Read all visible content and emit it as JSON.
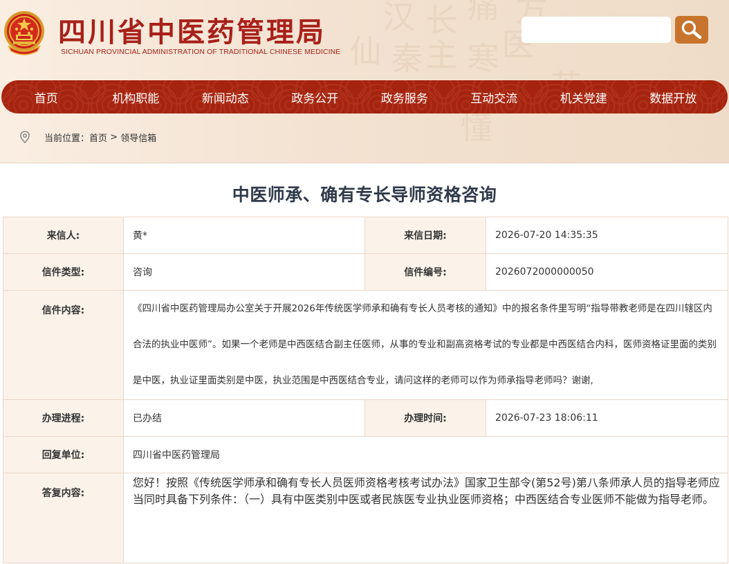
{
  "header": {
    "site_title": "四川省中医药管理局",
    "site_subtitle": "SICHUAN PROVINCIAL ADMINISTRATION OF TRADITIONAL CHINESE MEDICINE",
    "search_placeholder": "",
    "search_value": "",
    "background_glyphs": [
      "汉",
      "秦",
      "长",
      "主",
      "痛",
      "寒",
      "医",
      "仙",
      "方",
      "懂",
      "苦"
    ]
  },
  "nav": {
    "items": [
      "首页",
      "机构职能",
      "新闻动态",
      "政务公开",
      "政务服务",
      "互动交流",
      "机关党建",
      "数据开放"
    ]
  },
  "breadcrumb": {
    "prefix": "当前位置：",
    "home": "首页",
    "separator": " > ",
    "current": "领导信箱"
  },
  "page_title": "中医师承、确有专长导师资格咨询",
  "letter": {
    "sender_label": "来信人:",
    "sender": "黄*",
    "date_label": "来信日期:",
    "date": "2026-07-20 14:35:35",
    "type_label": "信件类型:",
    "type": "咨询",
    "number_label": "信件编号:",
    "number": "2026072000000050",
    "content_label": "信件内容:",
    "content": "《四川省中医药管理局办公室关于开展2026年传统医学师承和确有专长人员考核的通知》中的报名条件里写明“指导带教老师是在四川辖区内合法的执业中医师”。如果一个老师是中西医结合副主任医师，从事的专业和副高资格考试的专业都是中西医结合内科，医师资格证里面的类别是中医，执业证里面类别是中医，执业范围是中西医结合专业，请问这样的老师可以作为师承指导老师吗？谢谢,",
    "progress_label": "办理进程:",
    "progress": "已办结",
    "handled_time_label": "办理时间:",
    "handled_time": "2026-07-23 18:06:11",
    "reply_unit_label": "回复单位:",
    "reply_unit": "四川省中医药管理局",
    "reply_label": "答复内容:",
    "reply": "您好！按照《传统医学师承和确有专长人员医师资格考核考试办法》国家卫生部令(第52号)第八条师承人员的指导老师应当同时具备下列条件：（一）具有中医类别中医或者民族医专业执业医师资格；中西医结合专业医师不能做为指导老师。"
  },
  "colors": {
    "brand_red": "#a8201a",
    "nav_bg": "#a5240f",
    "search_button": "#c8742d",
    "label_bg": "#fbf3ea",
    "border": "#ead6c7",
    "title_color": "#2f3a4a"
  },
  "icons": {
    "emblem": "national-emblem-icon",
    "search": "search-icon",
    "location": "location-pin-icon"
  }
}
